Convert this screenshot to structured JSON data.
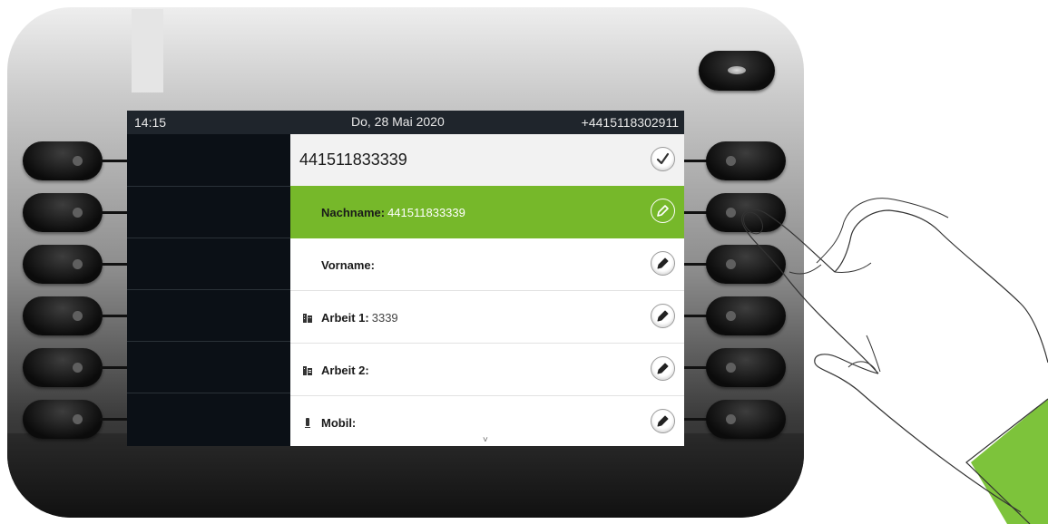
{
  "status_bar": {
    "time": "14:15",
    "date": "Do, 28 Mai 2020",
    "own_number": "+4415118302911"
  },
  "form": {
    "header_number": "441511833339",
    "confirm_icon": "check-icon",
    "rows": [
      {
        "label": "Nachname:",
        "value": "441511833339",
        "icon": "",
        "selected": true
      },
      {
        "label": "Vorname:",
        "value": "",
        "icon": "",
        "selected": false
      },
      {
        "label": "Arbeit 1:",
        "value": "3339",
        "icon": "office-building-icon",
        "selected": false
      },
      {
        "label": "Arbeit 2:",
        "value": "",
        "icon": "office-building-2-icon",
        "selected": false
      },
      {
        "label": "Mobil:",
        "value": "",
        "icon": "mobile-phone-icon",
        "selected": false
      }
    ],
    "edit_icon": "pencil-icon",
    "more_indicator": "˅"
  },
  "colors": {
    "selected_row": "#76b82a",
    "display_background": "#0b0f14",
    "status_bar": "#1f252c",
    "hand_cuff": "#7dc33b"
  }
}
